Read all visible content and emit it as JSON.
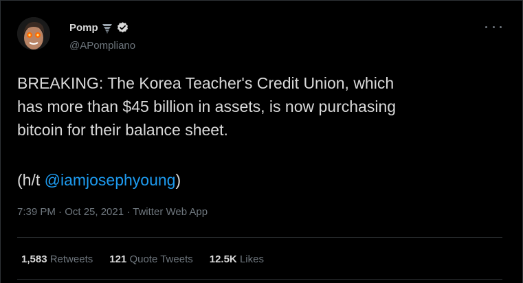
{
  "tweet": {
    "display_name": "Pomp",
    "name_emoji": "tornado-icon",
    "verified": true,
    "handle": "@APompliano",
    "text": "BREAKING: The Korea Teacher's Credit Union, which\nhas more than $45 billion in assets, is now purchasing\nbitcoin for their balance sheet.",
    "ht_prefix": "(h/t ",
    "ht_mention": "@iamjosephyoung",
    "ht_suffix": ")",
    "meta": "7:39 PM · Oct 25, 2021 · Twitter Web App",
    "stats": [
      {
        "count": "1,583",
        "label": "Retweets"
      },
      {
        "count": "121",
        "label": "Quote Tweets"
      },
      {
        "count": "12.5K",
        "label": "Likes"
      }
    ]
  },
  "colors": {
    "background": "#000000",
    "text": "#d9d9d9",
    "muted": "#6e767d",
    "link": "#1d9bf0",
    "border": "#2f3336"
  }
}
